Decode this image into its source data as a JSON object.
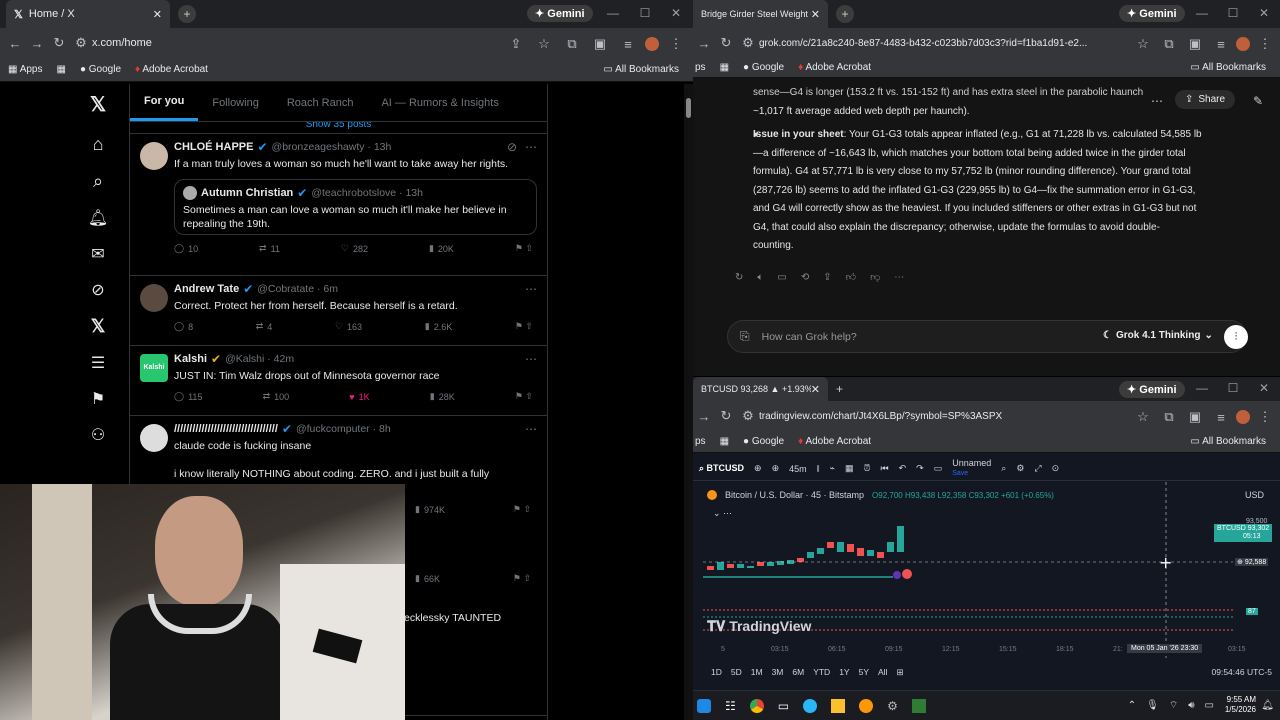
{
  "left_window": {
    "tab_title": "Home / X",
    "gemini": "Gemini",
    "url": "x.com/home",
    "bookmarks": {
      "apps": "Apps",
      "google": "Google",
      "acrobat": "Adobe Acrobat",
      "all": "All Bookmarks"
    }
  },
  "x": {
    "tabs": [
      "For you",
      "Following",
      "Roach Ranch",
      "AI — Rumors & Insights"
    ],
    "show_posts": "Show 35 posts",
    "tweets": [
      {
        "name": "CHLOÉ HAPPE",
        "handle": "@bronzeageshawty · 13h",
        "text": "If a man truly loves a woman so much he'll want to take away her rights.",
        "quote_name": "Autumn Christian",
        "quote_handle": "@teachrobotslove · 13h",
        "quote_text": "Sometimes a man can love a woman so much it'll make her believe in repealing the 19th.",
        "replies": "10",
        "reposts": "11",
        "likes": "282",
        "views": "20K"
      },
      {
        "name": "Andrew Tate",
        "handle": "@Cobratate · 6m",
        "text": "Correct. Protect her from herself. Because herself is a retard.",
        "replies": "8",
        "reposts": "4",
        "likes": "163",
        "views": "2.6K"
      },
      {
        "name": "Kalshi",
        "handle": "@Kalshi · 42m",
        "text": "JUST IN: Tim Walz drops out of Minnesota governor race",
        "replies": "115",
        "reposts": "100",
        "likes": "1K",
        "views": "28K",
        "logo": "Kalshi"
      },
      {
        "name": "//////////////////////////////////",
        "handle": "@fuckcomputer · 8h",
        "text": "claude code is fucking insane",
        "text2": "i know literally NOTHING about coding. ZERO. and i just built a fully",
        "views": "974K"
      }
    ],
    "views2": "66K",
    "partial": "ecklessky TAUNTED"
  },
  "grok_window": {
    "tab_title": "Bridge Girder Steel Weight Calc",
    "gemini": "Gemini",
    "url": "grok.com/c/21a8c240-8e87-4483-b432-c023bb7d03c3?rid=f1ba1d91-e2...",
    "bookmarks": {
      "apps": "ps",
      "google": "Google",
      "acrobat": "Adobe Acrobat",
      "all": "All Bookmarks"
    },
    "share": "Share",
    "para1_line1": "sense—G4 is longer (153.2 ft vs. 151-152 ft) and has extra steel in the parabolic haunch",
    "para1_line2": "~1,017 ft average added web depth per haunch).",
    "issue_label": "Issue in your sheet",
    "issue_lines": [
      ": Your G1-G3 totals appear inflated (e.g., G1 at 71,228 lb vs. calculated 54,585 lb",
      "—a difference of ~16,643 lb, which matches your bottom total being added twice in the girder total",
      "formula). G4 at 57,771 lb is very close to my 57,752 lb (minor rounding difference). Your grand total",
      "(287,726 lb) seems to add the inflated G1-G3 (229,955 lb) to G4—fix the summation error in G1-G3,",
      "and G4 will correctly show as the heaviest. If you included stiffeners or other extras in G1-G3 but not",
      "G4, that could also explain the discrepancy; otherwise, update the formulas to avoid double-",
      "counting."
    ],
    "input_placeholder": "How can Grok help?",
    "model": "Grok 4.1 Thinking"
  },
  "tv_window": {
    "tab_title": "BTCUSD 93,268 ▲ +1.93% Unn",
    "gemini": "Gemini",
    "url": "tradingview.com/chart/Jt4X6LBp/?symbol=SP%3ASPX",
    "bookmarks": {
      "apps": "ps",
      "google": "Google",
      "acrobat": "Adobe Acrobat",
      "all": "All Bookmarks"
    },
    "symbol": "BTCUSD",
    "interval": "45m",
    "layout": "Unnamed",
    "layout_sub": "Save",
    "pair": "Bitcoin / U.S. Dollar · 45 · Bitstamp",
    "ohlc": "O92,700 H93,438 L92,358 C93,302 +601 (+0.65%)",
    "currency": "USD",
    "price_tag": "BTCUSD",
    "price_tag_val": "93,302",
    "price_tag_time": "05:13",
    "p_top": "93,500",
    "p_cross": "92,588",
    "logo": "TradingView",
    "xticks": [
      "5",
      "03:15",
      "06:15",
      "09:15",
      "12:15",
      "15:15",
      "18:15",
      "21:",
      "03:15"
    ],
    "cursor_date": "Mon 05 Jan '26  23:30",
    "ranges": [
      "1D",
      "5D",
      "1M",
      "3M",
      "6M",
      "YTD",
      "1Y",
      "5Y",
      "All"
    ],
    "time": "09:54:46 UTC-5",
    "ind_val": "87"
  },
  "taskbar": {
    "time": "9:55 AM",
    "date": "1/5/2026"
  }
}
